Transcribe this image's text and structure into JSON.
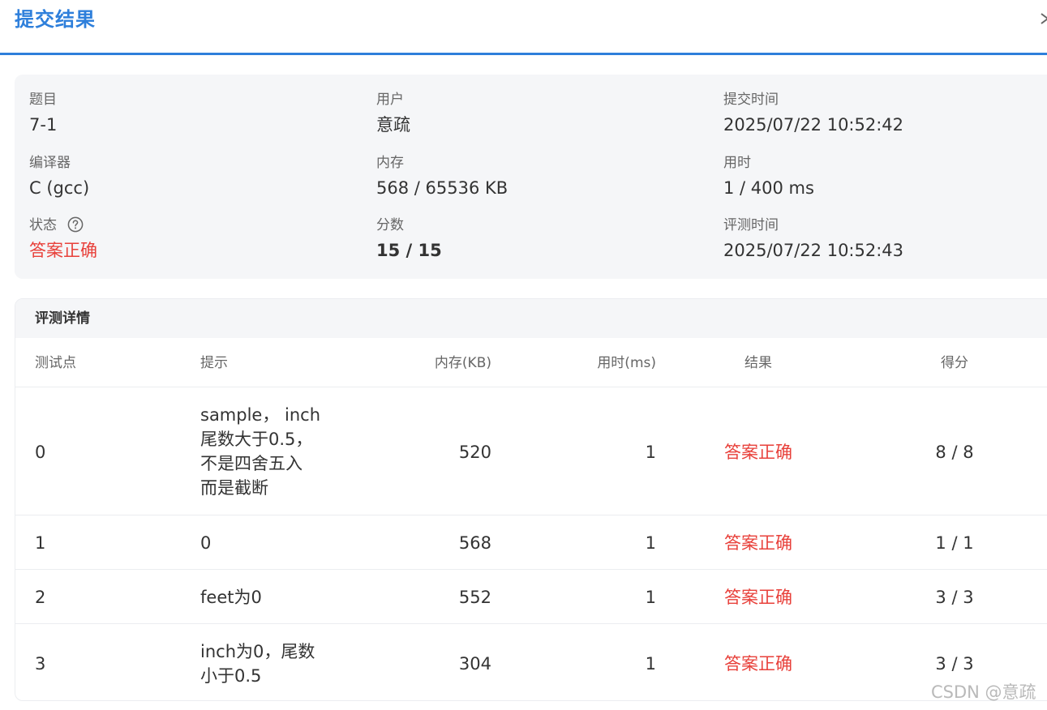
{
  "dialog": {
    "title": "提交结果"
  },
  "info": {
    "problem_label": "题目",
    "problem_value": "7-1",
    "user_label": "用户",
    "user_value": "意疏",
    "submit_time_label": "提交时间",
    "submit_time_value": "2025/07/22 10:52:42",
    "compiler_label": "编译器",
    "compiler_value": "C (gcc)",
    "memory_label": "内存",
    "memory_value": "568 / 65536 KB",
    "time_label": "用时",
    "time_value": "1 / 400 ms",
    "status_label": "状态",
    "status_value": "答案正确",
    "score_label": "分数",
    "score_value": "15 / 15",
    "judge_time_label": "评测时间",
    "judge_time_value": "2025/07/22 10:52:43"
  },
  "details": {
    "title": "评测详情",
    "columns": {
      "test": "测试点",
      "hint": "提示",
      "memory": "内存(KB)",
      "time": "用时(ms)",
      "result": "结果",
      "score": "得分"
    },
    "rows": [
      {
        "test": "0",
        "hint": "sample， inch\n尾数大于0.5，\n不是四舍五入\n而是截断",
        "memory": "520",
        "time": "1",
        "result": "答案正确",
        "score": "8 / 8"
      },
      {
        "test": "1",
        "hint": "0",
        "memory": "568",
        "time": "1",
        "result": "答案正确",
        "score": "1 / 1"
      },
      {
        "test": "2",
        "hint": "feet为0",
        "memory": "552",
        "time": "1",
        "result": "答案正确",
        "score": "3 / 3"
      },
      {
        "test": "3",
        "hint": "inch为0，尾数\n小于0.5",
        "memory": "304",
        "time": "1",
        "result": "答案正确",
        "score": "3 / 3"
      }
    ]
  },
  "watermark": "CSDN @意疏",
  "colors": {
    "accent": "#2e7fdb",
    "status_ok": "#e8403a",
    "panel_bg": "#f5f6f8"
  }
}
